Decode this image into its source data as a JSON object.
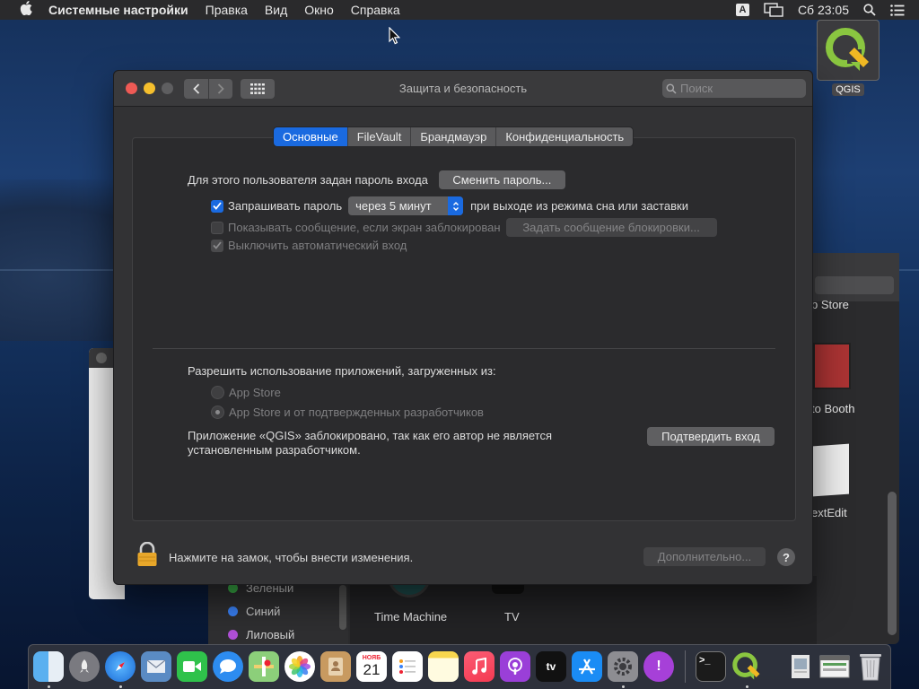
{
  "menubar": {
    "app_name": "Системные настройки",
    "items": [
      "Правка",
      "Вид",
      "Окно",
      "Справка"
    ],
    "input_indicator": "A",
    "clock": "Сб 23:05"
  },
  "desktop": {
    "qgis_label": "QGIS"
  },
  "window": {
    "title": "Защита и безопасность",
    "search_placeholder": "Поиск",
    "tabs": [
      "Основные",
      "FileVault",
      "Брандмауэр",
      "Конфиденциальность"
    ],
    "active_tab": "Основные",
    "general": {
      "password_set_label": "Для этого пользователя задан пароль входа",
      "change_password_button": "Сменить пароль...",
      "require_password_label": "Запрашивать пароль",
      "require_password_checked": true,
      "require_password_delay": "через 5 минут",
      "require_password_suffix": "при выходе из режима сна или заставки",
      "show_message_label": "Показывать сообщение, если экран заблокирован",
      "show_message_checked": false,
      "set_lock_message_button": "Задать сообщение блокировки...",
      "disable_autologin_label": "Выключить автоматический вход",
      "disable_autologin_checked": true,
      "allow_apps_label": "Разрешить использование приложений, загруженных из:",
      "option_app_store": "App Store",
      "option_app_store_devs": "App Store и от подтвержденных разработчиков",
      "selected_option": "App Store и от подтвержденных разработчиков",
      "blocked_message_line1": "Приложение «QGIS» заблокировано, так как его автор не является",
      "blocked_message_line2": "установленным разработчиком.",
      "confirm_login_button": "Подтвердить вход"
    },
    "footer": {
      "lock_text": "Нажмите на замок, чтобы внести изменения.",
      "advanced_button": "Дополнительно...",
      "help_button": "?"
    }
  },
  "background_window": {
    "sidebar_tags": [
      {
        "label": "Зеленый",
        "color": "#3db54a"
      },
      {
        "label": "Синий",
        "color": "#3a82f7"
      },
      {
        "label": "Лиловый",
        "color": "#b150d8"
      }
    ],
    "apps": [
      "Time Machine",
      "TV"
    ],
    "partial_apps": [
      "p Store",
      "to Booth",
      "extEdit"
    ]
  },
  "dock": {
    "apps": [
      "Finder",
      "Launchpad",
      "Safari",
      "Mail",
      "FaceTime",
      "Messages",
      "Maps",
      "Photos",
      "Contacts",
      "Calendar",
      "Reminders",
      "Notes",
      "Music",
      "Podcasts",
      "TV",
      "App Store",
      "System Preferences",
      "Feedback Assistant",
      "Terminal",
      "QGIS",
      "Preview",
      "Downloads",
      "Trash"
    ],
    "calendar_day": "21",
    "calendar_month": "НОЯБ"
  }
}
